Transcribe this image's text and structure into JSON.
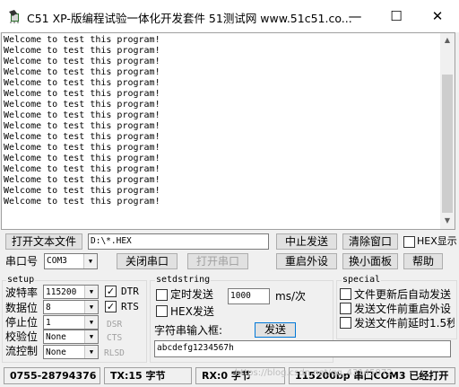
{
  "window": {
    "title": "C51 XP-版编程试验一体化开发套件 51测试网 www.51c51.co...",
    "app_icon": "app-chip-icon",
    "minimize_icon": "—",
    "maximize_icon": "☐",
    "close_icon": "✕"
  },
  "receive": {
    "lines": [
      "Welcome to test this program!",
      "Welcome to test this program!",
      "Welcome to test this program!",
      "Welcome to test this program!",
      "Welcome to test this program!",
      "Welcome to test this program!",
      "Welcome to test this program!",
      "Welcome to test this program!",
      "Welcome to test this program!",
      "Welcome to test this program!",
      "Welcome to test this program!",
      "Welcome to test this program!",
      "Welcome to test this program!",
      "Welcome to test this program!",
      "Welcome to test this program!",
      "Welcome to test this program!"
    ]
  },
  "toolbar1": {
    "open_file": "打开文本文件",
    "file_path": "D:\\*.HEX",
    "stop_send": "中止发送",
    "clear_window": "清除窗口",
    "hex_display": "HEX显示"
  },
  "toolbar2": {
    "port_label": "串口号",
    "port_value": "COM3",
    "close_port": "关闭串口",
    "open_port": "打开串口",
    "reset_ext": "重启外设",
    "mini_panel": "换小面板",
    "help": "帮助"
  },
  "setup": {
    "title": "setup",
    "baud_label": "波特率",
    "baud_value": "115200",
    "databits_label": "数据位",
    "databits_value": "8",
    "stopbits_label": "停止位",
    "stopbits_value": "1",
    "parity_label": "校验位",
    "parity_value": "None",
    "flow_label": "流控制",
    "flow_value": "None",
    "dtr": "DTR",
    "rts": "RTS",
    "dsr": "DSR",
    "cts": "CTS",
    "rlsd": "RLSD"
  },
  "setdstring": {
    "title": "setdstring",
    "timed_send": "定时发送",
    "interval": "1000",
    "unit": "ms/次",
    "hex_send": "HEX发送",
    "input_label": "字符串输入框:",
    "send": "发送",
    "input_value": "abcdefg1234567h"
  },
  "special": {
    "title": "special",
    "opt1": "文件更新后自动发送",
    "opt2": "发送文件前重启外设",
    "opt3": "发送文件前延时1.5秒"
  },
  "status": {
    "phone": "0755-28794376",
    "tx": "TX:15 字节",
    "rx": "RX:0 字节",
    "port_state": "115200bp 串口COM3 已经打开"
  },
  "watermark": "https://blog.csdn.net/qq_43145072"
}
